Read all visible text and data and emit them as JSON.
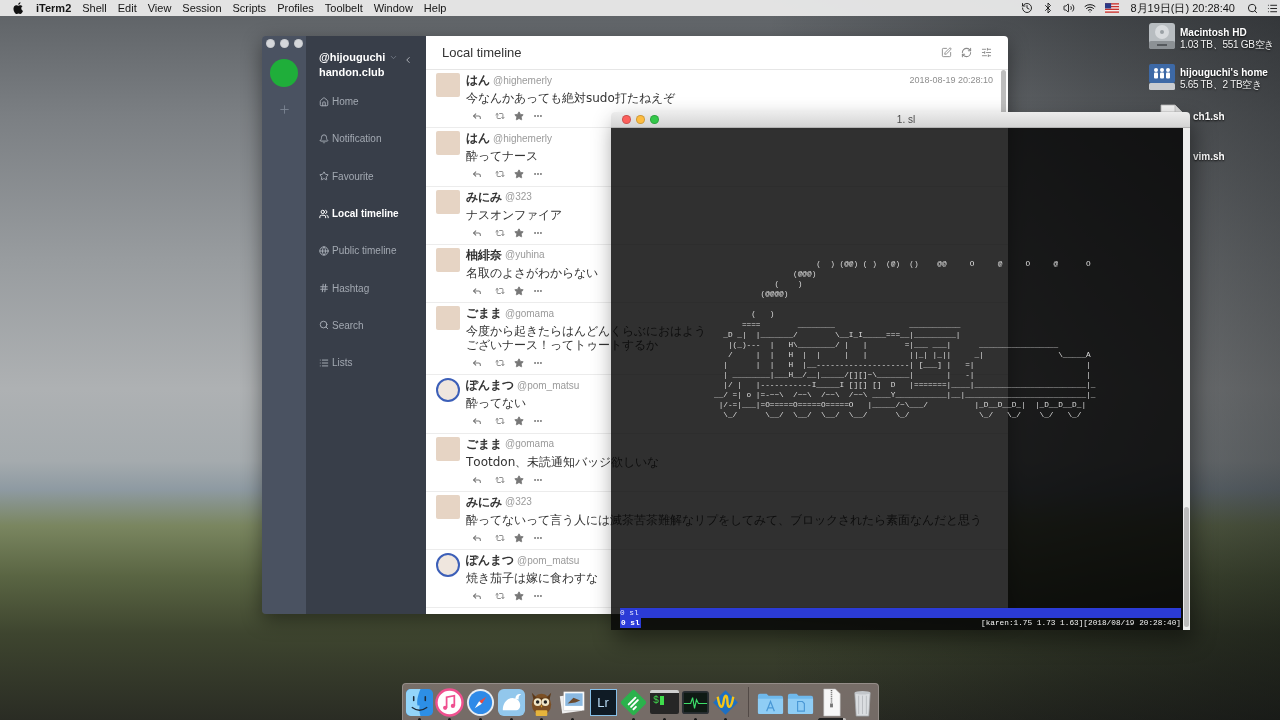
{
  "menu_bar": {
    "app_name": "iTerm2",
    "menus": [
      "Shell",
      "Edit",
      "View",
      "Session",
      "Scripts",
      "Profiles",
      "Toolbelt",
      "Window",
      "Help"
    ],
    "clock": "8月19日(日) 20:28:40"
  },
  "desktop_icons": [
    {
      "kind": "drive",
      "name": "Macintosh HD",
      "detail": "1.03 TB、551 GB空き"
    },
    {
      "kind": "network_drive",
      "name": "hijouguchi's home",
      "detail": "5.65 TB、2 TB空き"
    },
    {
      "kind": "script_top",
      "name": "ch1.sh"
    },
    {
      "kind": "script_covered",
      "name": "vim.sh"
    }
  ],
  "timeline_window": {
    "active": false,
    "account": {
      "handle": "@hijouguchi",
      "instance": "handon.club"
    },
    "nav": [
      {
        "kind": "home",
        "label": "Home",
        "selected": false
      },
      {
        "kind": "notification",
        "label": "Notification",
        "selected": false
      },
      {
        "kind": "favourite",
        "label": "Favourite",
        "selected": false
      },
      {
        "kind": "local",
        "label": "Local timeline",
        "selected": true
      },
      {
        "kind": "public",
        "label": "Public timeline",
        "selected": false
      },
      {
        "kind": "hashtag",
        "label": "Hashtag",
        "selected": false
      },
      {
        "kind": "search",
        "label": "Search",
        "selected": false
      },
      {
        "kind": "lists",
        "label": "Lists",
        "selected": false
      }
    ],
    "title": "Local timeline",
    "posts": [
      {
        "kind": "square",
        "name": "はん",
        "handle": "@highemerly",
        "time": "2018-08-19 20:28:10",
        "text": "今なんかあっても絶対sudo打たねえぞ"
      },
      {
        "kind": "square",
        "name": "はん",
        "handle": "@highemerly",
        "text": "酔ってナース"
      },
      {
        "kind": "square",
        "name": "みにみ",
        "handle": "@323",
        "text": "ナスオンファイア"
      },
      {
        "kind": "square",
        "name": "柚緋奈",
        "handle": "@yuhina",
        "text": "名取のよさがわからない"
      },
      {
        "kind": "square",
        "name": "ごまま",
        "handle": "@gomama",
        "text": "今度から起きたらはんどんくらぶにおはようございナース！ってトゥートするか"
      },
      {
        "kind": "round",
        "name": "ぽんまつ",
        "handle": "@pom_matsu",
        "text": "酔ってない"
      },
      {
        "kind": "square",
        "name": "ごまま",
        "handle": "@gomama",
        "text": "Tootdon、未読通知バッジ欲しいな"
      },
      {
        "kind": "square",
        "name": "みにみ",
        "handle": "@323",
        "text": "酔ってないって言う人には滅茶苦茶難解なリプをしてみて、ブロックされたら素面なんだと思う"
      },
      {
        "kind": "round",
        "name": "ぽんまつ",
        "handle": "@pom_matsu",
        "text": "焼き茄子は嫁に食わすな"
      }
    ]
  },
  "terminal": {
    "active": true,
    "title": "1. sl",
    "art": "                      (  ) (@@) ( )  (@)  ()    @@     O     @     O     @      O\n                 (@@@)\n             (    )\n          (@@@@)\n\n        (   )\n      ====        ________                ___________\n  _D _|  |_______/        \\__I_I_____===__|_________|\n   |(_)---  |   H\\________/ |   |        =|___ ___|      _________________\n   /     |  |   H  |  |     |   |         ||_| |_||     _|                \\_____A\n  |      |  |   H  |__--------------------| [___] |   =|                        |\n  | ________|___H__/__|_____/[][]~\\_______|       |   -|                        |\n  |/ |   |-----------I_____I [][] []  D   |=======|____|________________________|_\n__/ =| o |=-~~\\  /~~\\  /~~\\  /~~\\ ____Y___________|__|__________________________|_\n |/-=|___|=O=====O=====O=====O   |_____/~\\___/          |_D__D__D_|  |_D__D__D_|\n  \\_/      \\__/  \\__/  \\__/  \\__/      \\_/               \\_/   \\_/    \\_/   \\_/",
    "window_list": "0 sl",
    "active_window": "0 sl",
    "status": "[karen:1.75 1.73 1.63][2018/08/19 20:28:40]"
  },
  "dock": {
    "apps": [
      {
        "kind": "finder",
        "running": true
      },
      {
        "kind": "music",
        "running": true
      },
      {
        "kind": "compass",
        "running": true
      },
      {
        "kind": "whale",
        "running": true
      },
      {
        "kind": "owl",
        "running": true
      },
      {
        "kind": "preview",
        "running": true
      },
      {
        "kind": "lightroom",
        "text": "Lr",
        "running": false
      },
      {
        "kind": "feed",
        "running": true
      },
      {
        "kind": "terminal",
        "text": "$",
        "running": true
      },
      {
        "kind": "activity",
        "running": true
      },
      {
        "kind": "wlogo",
        "running": true
      }
    ],
    "stacks": [
      {
        "kind": "apps_folder"
      },
      {
        "kind": "docs_folder"
      },
      {
        "kind": "zip",
        "level": 0.9
      },
      {
        "kind": "trash"
      }
    ]
  }
}
